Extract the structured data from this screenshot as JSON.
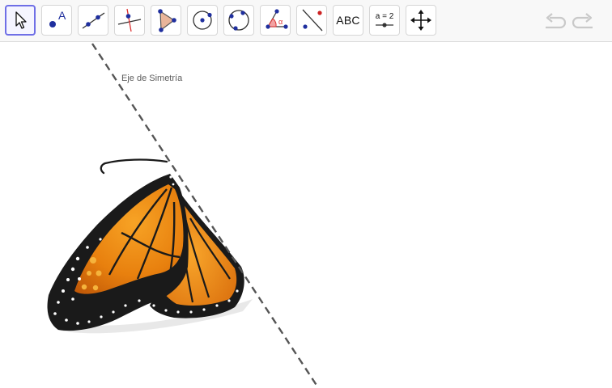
{
  "toolbar": {
    "tools": [
      {
        "name": "move-tool",
        "icon": "arrow-cursor-icon",
        "selected": true
      },
      {
        "name": "point-tool",
        "icon": "point-with-label-icon",
        "label": "A"
      },
      {
        "name": "line-tool",
        "icon": "line-through-two-points-icon"
      },
      {
        "name": "perpendicular-line-tool",
        "icon": "perpendicular-line-icon"
      },
      {
        "name": "polygon-tool",
        "icon": "polygon-icon"
      },
      {
        "name": "circle-center-point-tool",
        "icon": "circle-center-point-icon"
      },
      {
        "name": "circle-three-points-tool",
        "icon": "circle-three-points-icon"
      },
      {
        "name": "angle-tool",
        "icon": "angle-icon",
        "label": "α"
      },
      {
        "name": "reflect-about-line-tool",
        "icon": "reflect-about-line-icon"
      },
      {
        "name": "text-tool",
        "icon": "text-icon",
        "label": "ABC"
      },
      {
        "name": "slider-tool",
        "icon": "slider-icon",
        "label": "a = 2"
      },
      {
        "name": "move-graphics-view-tool",
        "icon": "move-cross-arrows-icon"
      }
    ],
    "undo_icon": "undo-icon",
    "redo_icon": "redo-icon"
  },
  "canvas": {
    "axis_label": "Eje de Simetría",
    "image": "monarch-butterfly-half",
    "colors": {
      "axis": "#555555",
      "selected_tool_border": "#6f6fe6",
      "point": "#1f2f9e",
      "wing_orange": "#f08a14",
      "wing_black": "#1a1a1a"
    }
  }
}
